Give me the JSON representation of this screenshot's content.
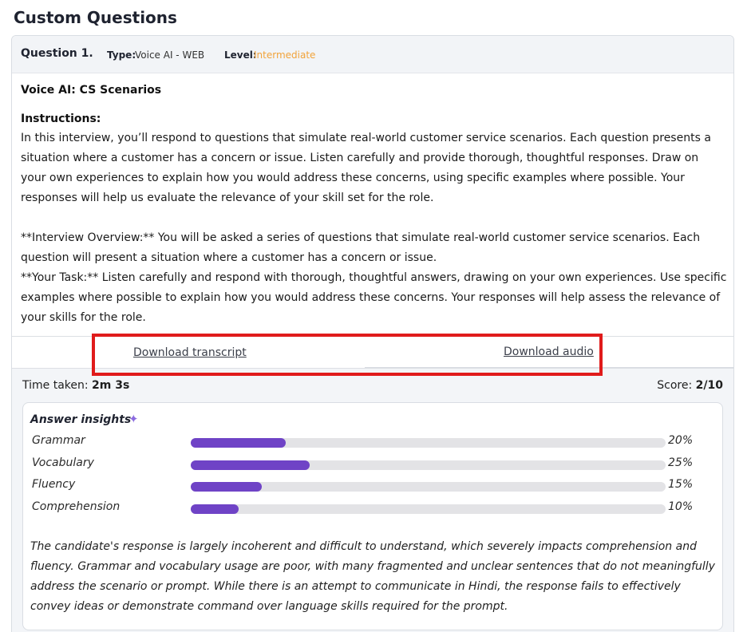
{
  "page": {
    "title": "Custom Questions"
  },
  "question": {
    "number_label": "Question 1.",
    "type_label": "Type:",
    "type_value": "Voice AI - WEB",
    "level_label": "Level:",
    "level_value": "Intermediate",
    "level_color": "#f2a33a",
    "name": "Voice AI: CS Scenarios",
    "instructions_label": "Instructions:",
    "instructions_p1": "In this interview, you’ll respond to questions that simulate real-world customer service scenarios. Each question presents a situation where a customer has a concern or issue. Listen carefully and provide thorough, thoughtful responses. Draw on your own experiences to explain how you would address these concerns, using specific examples where possible. Your responses will help us evaluate the relevance of your skill set for the role.",
    "instructions_p2_line1": "**Interview Overview:** You will be asked a series of questions that simulate real-world customer service scenarios. Each question will present a situation where a customer has a concern or issue.",
    "instructions_p2_line2": "**Your Task:** Listen carefully and respond with thorough, thoughtful answers, drawing on your own experiences. Use specific examples where possible to explain how you would address these concerns. Your responses will help assess the relevance of your skills for the role."
  },
  "downloads": {
    "transcript_label": "Download transcript",
    "audio_label": "Download audio",
    "highlight_color": "#e01b1b"
  },
  "result": {
    "time_label": "Time taken:",
    "time_value": "2m 3s",
    "score_label": "Score:",
    "score_value": "2/10"
  },
  "insights": {
    "title": "Answer insights",
    "icon": "sparkle-icon",
    "bar_color": "#6f43c6",
    "metrics": [
      {
        "label": "Grammar",
        "value": 20,
        "display": "20%"
      },
      {
        "label": "Vocabulary",
        "value": 25,
        "display": "25%"
      },
      {
        "label": "Fluency",
        "value": 15,
        "display": "15%"
      },
      {
        "label": "Comprehension",
        "value": 10,
        "display": "10%"
      }
    ],
    "summary": "The candidate's response is largely incoherent and difficult to understand, which severely impacts comprehension and fluency. Grammar and vocabulary usage are poor, with many fragmented and unclear sentences that do not meaningfully address the scenario or prompt. While there is an attempt to communicate in Hindi, the response fails to effectively convey ideas or demonstrate command over language skills required for the prompt."
  }
}
